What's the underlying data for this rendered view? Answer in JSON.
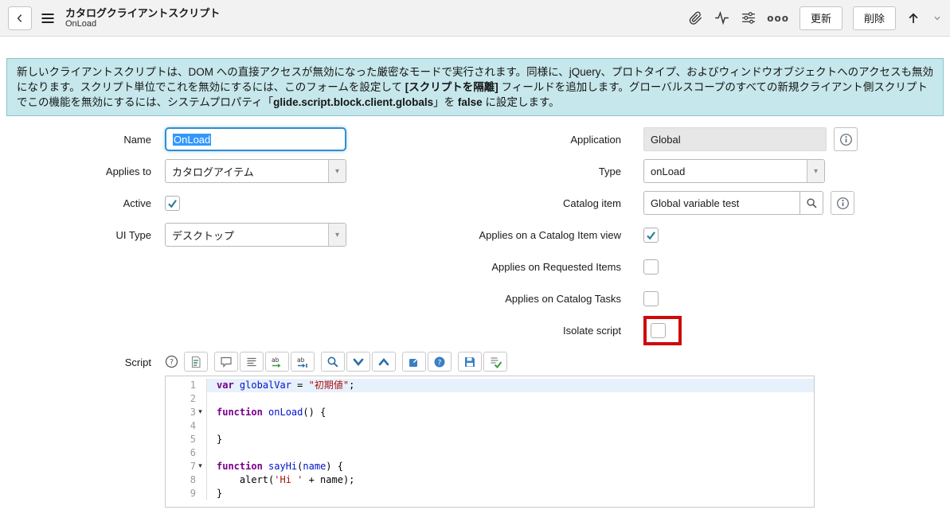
{
  "header": {
    "title": "カタログクライアントスクリプト",
    "subtitle": "OnLoad",
    "update_button": "更新",
    "delete_button": "削除"
  },
  "icons": {
    "more": "ooo",
    "dropdown": "▾",
    "fold": "▾"
  },
  "banner": {
    "p1": "新しいクライアントスクリプトは、DOM への直接アクセスが無効になった厳密なモードで実行されます。同様に、jQuery、プロトタイプ、およびウィンドウオブジェクトへのアクセスも無効になります。スクリプト単位でこれを無効にするには、このフォームを設定して ",
    "b1": "[スクリプトを隔離]",
    "p2": " フィールドを追加します。グローバルスコープのすべての新規クライアント側スクリプトでこの機能を無効にするには、システムプロパティ「",
    "b2": "glide.script.block.client.globals",
    "p3": "」を ",
    "b3": "false",
    "p4": " に設定します。"
  },
  "form": {
    "name": {
      "label": "Name",
      "value": "OnLoad"
    },
    "applies_to": {
      "label": "Applies to",
      "value": "カタログアイテム"
    },
    "active": {
      "label": "Active",
      "checked": true
    },
    "ui_type": {
      "label": "UI Type",
      "value": "デスクトップ"
    },
    "application": {
      "label": "Application",
      "value": "Global"
    },
    "type": {
      "label": "Type",
      "value": "onLoad"
    },
    "catalog_item": {
      "label": "Catalog item",
      "value": "Global variable test"
    },
    "applies_catalog_item_view": {
      "label": "Applies on a Catalog Item view",
      "checked": true
    },
    "applies_requested_items": {
      "label": "Applies on Requested Items",
      "checked": false
    },
    "applies_catalog_tasks": {
      "label": "Applies on Catalog Tasks",
      "checked": false
    },
    "isolate_script": {
      "label": "Isolate script",
      "checked": false
    }
  },
  "script": {
    "label": "Script",
    "lines": [
      {
        "num": 1,
        "active": true,
        "tokens": [
          {
            "c": "kw",
            "t": "var"
          },
          {
            "c": "pl",
            "t": " "
          },
          {
            "c": "def",
            "t": "globalVar"
          },
          {
            "c": "pl",
            "t": " = "
          },
          {
            "c": "str",
            "t": "\"初期値\""
          },
          {
            "c": "pl",
            "t": ";"
          }
        ]
      },
      {
        "num": 2,
        "tokens": []
      },
      {
        "num": 3,
        "fold": true,
        "tokens": [
          {
            "c": "kw",
            "t": "function"
          },
          {
            "c": "pl",
            "t": " "
          },
          {
            "c": "def",
            "t": "onLoad"
          },
          {
            "c": "pl",
            "t": "() {"
          }
        ]
      },
      {
        "num": 4,
        "tokens": []
      },
      {
        "num": 5,
        "tokens": [
          {
            "c": "pl",
            "t": "}"
          }
        ]
      },
      {
        "num": 6,
        "tokens": []
      },
      {
        "num": 7,
        "fold": true,
        "tokens": [
          {
            "c": "kw",
            "t": "function"
          },
          {
            "c": "pl",
            "t": " "
          },
          {
            "c": "def",
            "t": "sayHi"
          },
          {
            "c": "pl",
            "t": "("
          },
          {
            "c": "def",
            "t": "name"
          },
          {
            "c": "pl",
            "t": ") {"
          }
        ]
      },
      {
        "num": 8,
        "tokens": [
          {
            "c": "pl",
            "t": "    alert("
          },
          {
            "c": "str",
            "t": "'Hi '"
          },
          {
            "c": "pl",
            "t": " + name);"
          }
        ]
      },
      {
        "num": 9,
        "tokens": [
          {
            "c": "pl",
            "t": "}"
          }
        ]
      }
    ]
  }
}
